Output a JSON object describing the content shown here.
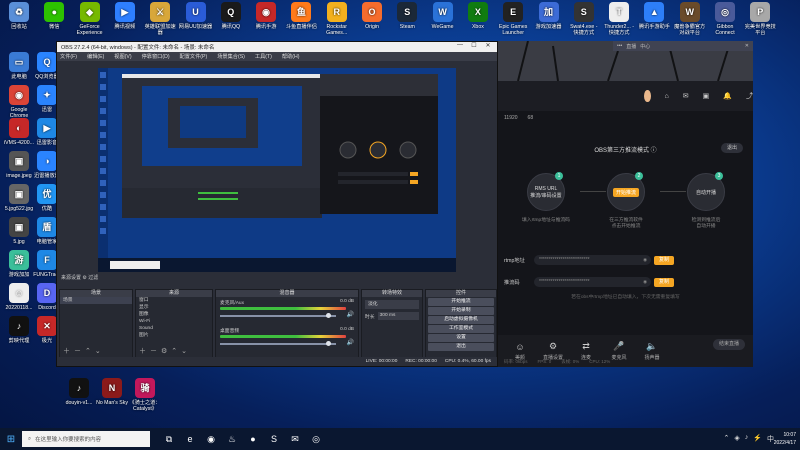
{
  "desktop_icons": [
    {
      "label": "回收站",
      "glyph": "♻",
      "color": "#5a8fd8"
    },
    {
      "label": "微信",
      "glyph": "●",
      "color": "#2dc100"
    },
    {
      "label": "GeForce Experience",
      "glyph": "◆",
      "color": "#76b900"
    },
    {
      "label": "腾讯视频",
      "glyph": "▶",
      "color": "#2e7fff"
    },
    {
      "label": "英雄联盟加速器",
      "glyph": "⚔",
      "color": "#d8a73a"
    },
    {
      "label": "网易UU加速器",
      "glyph": "U",
      "color": "#2a5cd8"
    },
    {
      "label": "腾讯QQ",
      "glyph": "Q",
      "color": "#1a1a1a"
    },
    {
      "label": "腾讯手游",
      "glyph": "◉",
      "color": "#c62828"
    },
    {
      "label": "斗鱼直播伴侣",
      "glyph": "鱼",
      "color": "#ff7a1a"
    },
    {
      "label": "Rockstar Games...",
      "glyph": "R",
      "color": "#f2b01e"
    },
    {
      "label": "Origin",
      "glyph": "O",
      "color": "#f56c2d"
    },
    {
      "label": "Steam",
      "glyph": "S",
      "color": "#1b2838"
    },
    {
      "label": "WeGame",
      "glyph": "W",
      "color": "#2a72d8"
    },
    {
      "label": "Xbox",
      "glyph": "X",
      "color": "#107c10"
    },
    {
      "label": "Epic Games Launcher",
      "glyph": "E",
      "color": "#222"
    },
    {
      "label": "游戏加速器",
      "glyph": "加",
      "color": "#3c6bd6"
    },
    {
      "label": "Swat4.exe - 快捷方式",
      "glyph": "S",
      "color": "#333"
    },
    {
      "label": "Thunder2... - 快捷方式",
      "glyph": "T",
      "color": "#eee"
    },
    {
      "label": "腾讯手游助手",
      "glyph": "▲",
      "color": "#2d7ff9"
    },
    {
      "label": "魔兽争霸官方对战平台",
      "glyph": "W",
      "color": "#6a4b2a"
    },
    {
      "label": "Gibbon Connect",
      "glyph": "◎",
      "color": "#4a5a9a"
    },
    {
      "label": "完美世界竞技平台",
      "glyph": "P",
      "color": "#a8a8a8"
    },
    {
      "label": "此电脑",
      "glyph": "▭",
      "color": "#3a7bd5"
    },
    {
      "label": "QQ浏览器",
      "glyph": "Q",
      "color": "#2a84ff"
    },
    {
      "label": "Google Chrome",
      "glyph": "◉",
      "color": "#db4437"
    },
    {
      "label": "迅雷",
      "glyph": "✦",
      "color": "#2a84ff"
    },
    {
      "label": "iVMS-4200...",
      "glyph": "◐",
      "color": "#c62828"
    },
    {
      "label": "迅雷影音",
      "glyph": "▶",
      "color": "#1e88e5"
    },
    {
      "label": "image.jpeg",
      "glyph": "▣",
      "color": "#555"
    },
    {
      "label": "迅雷播放器",
      "glyph": "◑",
      "color": "#2a84ff"
    },
    {
      "label": "5.jpg522.jpg",
      "glyph": "▣",
      "color": "#666"
    },
    {
      "label": "优酷",
      "glyph": "优",
      "color": "#2196f3"
    },
    {
      "label": "5.jpg",
      "glyph": "▣",
      "color": "#444"
    },
    {
      "label": "电脑管家",
      "glyph": "盾",
      "color": "#1e88e5"
    },
    {
      "label": "游戏加加",
      "glyph": "游",
      "color": "#3bbf9a"
    },
    {
      "label": "FUNGTrack",
      "glyph": "F",
      "color": "#1e88e5"
    },
    {
      "label": "20220118...",
      "glyph": "☺",
      "color": "#eee"
    },
    {
      "label": "Discord",
      "glyph": "D",
      "color": "#5865f2"
    },
    {
      "label": "剪映代理",
      "glyph": "♪",
      "color": "#111"
    },
    {
      "label": "极光",
      "glyph": "✕",
      "color": "#c62828"
    },
    {
      "label": "douyin-v1...",
      "glyph": "♪",
      "color": "#111"
    },
    {
      "label": "No Man's Sky",
      "glyph": "N",
      "color": "#8b1a1a"
    },
    {
      "label": "《骑士之道：Catalyst》",
      "glyph": "骑",
      "color": "#c2185b"
    }
  ],
  "obs": {
    "title": "OBS 27.2.4 (64-bit, windows) - 配置文件: 未命名 - 场景: 未命名",
    "menu": [
      "文件(F)",
      "编辑(E)",
      "视图(V)",
      "停靠窗口(D)",
      "配置文件(P)",
      "场景集合(S)",
      "工具(T)",
      "帮助(H)"
    ],
    "status_line": "来源设置  ⚙  过滤",
    "docks": {
      "scenes": {
        "title": "场景",
        "items": [
          "场景"
        ]
      },
      "sources": {
        "title": "来源",
        "items": [
          "窗口",
          "显示",
          "图像",
          "Wi-Fi",
          "Sound",
          "图片"
        ]
      },
      "mixer": {
        "title": "混音器",
        "tracks": [
          {
            "name": "麦克风/Aux",
            "db": "0.0 dB"
          },
          {
            "name": "桌面音频",
            "db": "0.0 dB"
          }
        ]
      },
      "transitions": {
        "title": "转场特效",
        "transition": "淡化",
        "duration_label": "时长",
        "duration": "300 ms"
      },
      "controls": {
        "title": "控件",
        "buttons": [
          "开始推流",
          "开始录制",
          "启动虚拟摄像机",
          "工作室模式",
          "设置",
          "退出"
        ]
      }
    },
    "footer": {
      "live": "LIVE: 00:00:00",
      "rec": "REC: 00:00:00",
      "cpu": "CPU: 0.4%, 60.00 fps"
    }
  },
  "app": {
    "tabs": [
      "•••",
      "直播",
      "中心"
    ],
    "info": {
      "followers": "11920",
      "other": "68"
    },
    "mode_title": "OBS第三方推流模式",
    "exit_label": "退出",
    "steps": [
      {
        "num": "1",
        "title": "RMS URL",
        "sub": "推流/串码设置",
        "desc": "填入rtmp地址与推流码"
      },
      {
        "num": "2",
        "title": "开始推流",
        "sub": "",
        "desc": "在三方推流软件\n点击开始推流"
      },
      {
        "num": "3",
        "title": "自动开播",
        "sub": "",
        "desc": "检测到推流后\n自动开播"
      }
    ],
    "rtmp_label": "rtmp地址",
    "rtmp_value": "**************************",
    "key_label": "推流码",
    "key_value": "**************************",
    "copy_label": "复制",
    "note": "若在obs中rtmp地址已自动填入，下次无需重复填写",
    "bottom_items": [
      "美颜",
      "直播设置",
      "连麦",
      "麦克风",
      "扬声器"
    ],
    "live_btn": "结束直播",
    "stats": [
      "码率: 0kbps",
      "FPS: 0",
      "丢帧: 0%",
      "CPU: 12%"
    ]
  },
  "taskbar": {
    "search_placeholder": "在这里输入你要搜索的内容",
    "apps": [
      "⧉",
      "e",
      "◉",
      "♨",
      "●",
      "S",
      "✉",
      "◎"
    ],
    "tray": [
      "⌃",
      "◈",
      "♪",
      "⚡",
      "中"
    ],
    "time": "10:07",
    "date": "2022/4/17"
  },
  "colors": {
    "accent": "#f5a623",
    "teal": "#3bbf9a",
    "obs_bg": "#2b2e38",
    "app_bg": "#14151a"
  }
}
